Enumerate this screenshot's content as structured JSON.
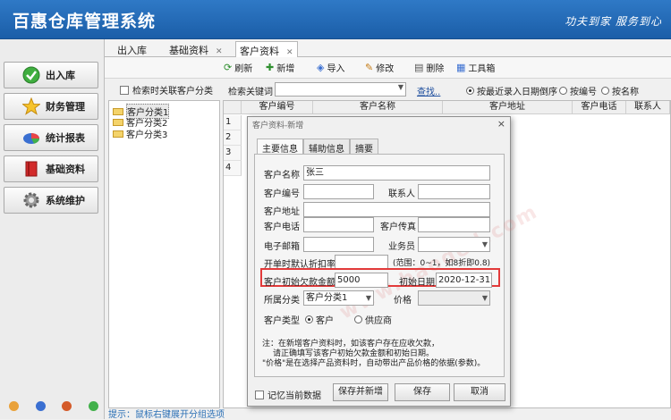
{
  "app": {
    "title": "百惠仓库管理系统",
    "slogan": "功夫到家  服务到心"
  },
  "nav": {
    "items": [
      {
        "label": "出入库",
        "icon": "check-circle-icon"
      },
      {
        "label": "财务管理",
        "icon": "star-icon"
      },
      {
        "label": "统计报表",
        "icon": "pie-chart-icon"
      },
      {
        "label": "基础资料",
        "icon": "book-icon"
      },
      {
        "label": "系统维护",
        "icon": "gear-icon"
      }
    ]
  },
  "tabs": [
    {
      "label": "出入库"
    },
    {
      "label": "基础资料"
    },
    {
      "label": "客户资料"
    }
  ],
  "toolbar": {
    "refresh": "刷新",
    "add": "新增",
    "import": "导入",
    "edit": "修改",
    "delete": "删除",
    "tools": "工具箱"
  },
  "tree": {
    "checkbox_label": "检索时关联客户分类",
    "nodes": [
      "客户分类1",
      "客户分类2",
      "客户分类3"
    ],
    "hint": "提示：鼠标右键展开分组选项"
  },
  "search": {
    "label": "检索关键词",
    "value": "",
    "find": "查找..",
    "radios": [
      {
        "label": "按最近录入日期倒序",
        "checked": true
      },
      {
        "label": "按编号",
        "checked": false
      },
      {
        "label": "按名称",
        "checked": false
      }
    ]
  },
  "grid": {
    "columns": [
      "客户编号",
      "客户名称",
      "客户地址",
      "客户电话",
      "联系人"
    ],
    "row_numbers": [
      "1",
      "2",
      "3",
      "4"
    ]
  },
  "dialog": {
    "title": "客户资料-新增",
    "close": "×",
    "tabs": [
      "主要信息",
      "辅助信息",
      "摘要"
    ],
    "fields": {
      "name_label": "客户名称",
      "name_value": "张三",
      "code_label": "客户编号",
      "code_value": "",
      "contact_label": "联系人",
      "contact_value": "",
      "address_label": "客户地址",
      "address_value": "",
      "phone_label": "客户电话",
      "phone_value": "",
      "fax_label": "客户传真",
      "fax_value": "",
      "email_label": "电子邮箱",
      "email_value": "",
      "salesman_label": "业务员",
      "salesman_value": "",
      "discount_label": "开单时默认折扣率",
      "discount_value": "",
      "discount_range": "(范围：0~1，如8折即0.8)",
      "debt_label": "客户初始欠款金额",
      "debt_value": "5000",
      "date_label": "初始日期",
      "date_value": "2020-12-31",
      "category_label": "所属分类",
      "category_value": "客户分类1",
      "price_label": "价格",
      "price_value": "",
      "type_label": "客户类型",
      "type_customer": "客户",
      "type_supplier": "供应商"
    },
    "note_lines": [
      "注：在新增客户资料时，如该客户存在应收欠款，",
      "请正确填写该客户初始欠款金额和初始日期。",
      "\"价格\"是在选择产品资料时，自动带出产品价格的依据(参数)。"
    ],
    "remember_label": "记忆当前数据",
    "buttons": {
      "save_new": "保存并新增",
      "save": "保存",
      "cancel": "取消"
    },
    "watermark": "www.haoded.com"
  },
  "colors": {
    "titlebar": "#1b5ea8",
    "highlight_box": "#e23a3a",
    "link": "#1f4f9e"
  }
}
